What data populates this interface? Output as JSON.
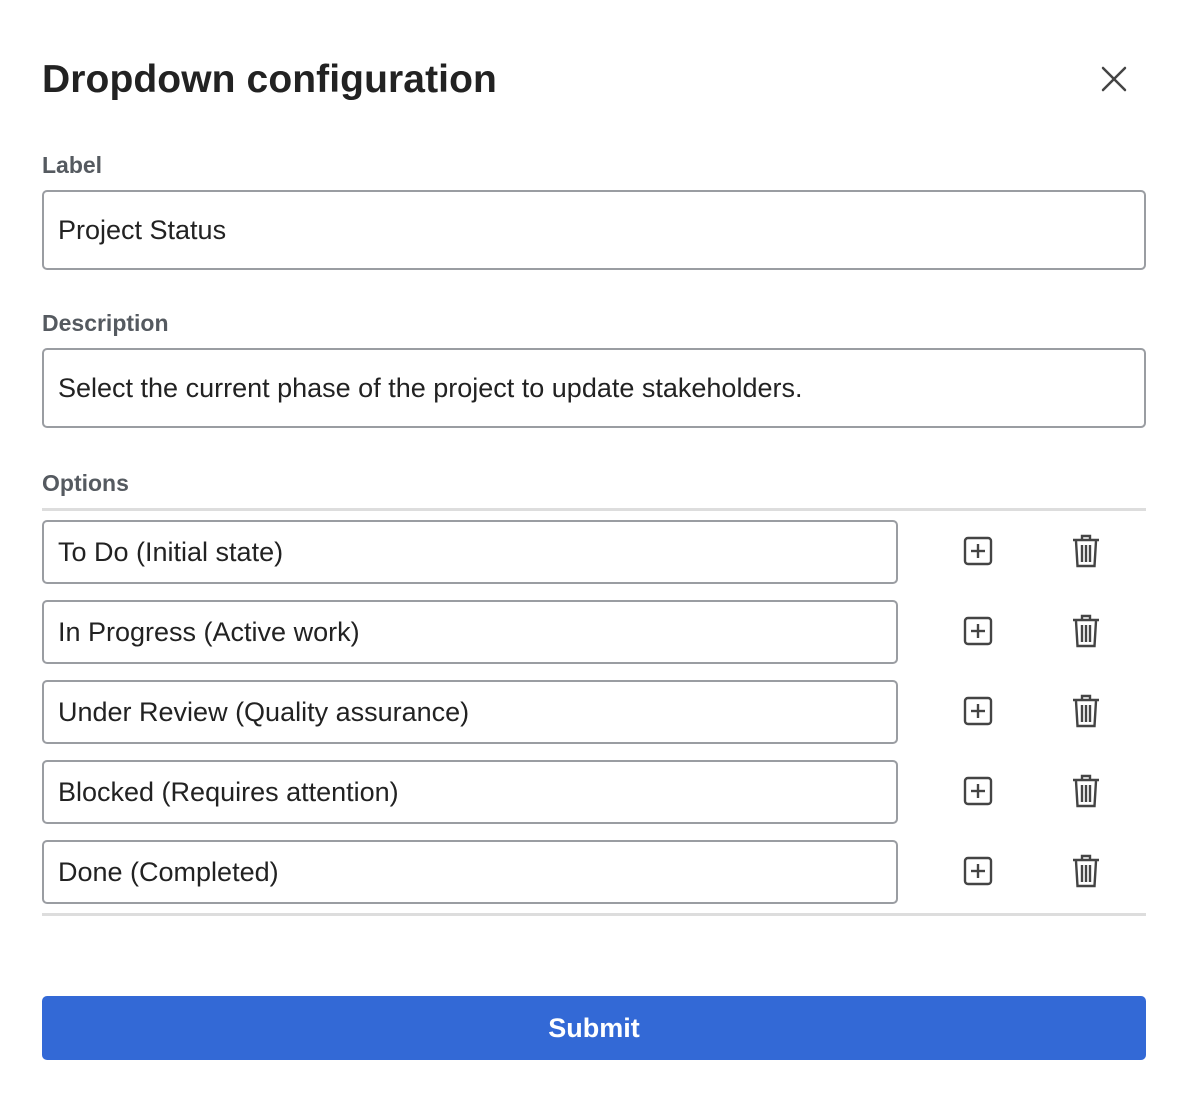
{
  "dialog": {
    "title": "Dropdown configuration",
    "close_icon": "close-icon"
  },
  "label_field": {
    "label": "Label",
    "value": "Project Status"
  },
  "description_field": {
    "label": "Description",
    "value": "Select the current phase of the project to update stakeholders."
  },
  "options": {
    "label": "Options",
    "add_icon": "plus-square-icon",
    "delete_icon": "trash-icon",
    "items": [
      {
        "value": "To Do (Initial state)"
      },
      {
        "value": "In Progress (Active work)"
      },
      {
        "value": "Under Review (Quality assurance)"
      },
      {
        "value": "Blocked (Requires attention)"
      },
      {
        "value": "Done (Completed)"
      }
    ]
  },
  "submit": {
    "label": "Submit"
  },
  "colors": {
    "primary": "#3369d6",
    "label_text": "#555a60",
    "input_border": "#9a9da2",
    "divider": "#dddddd",
    "icon": "#444444"
  }
}
